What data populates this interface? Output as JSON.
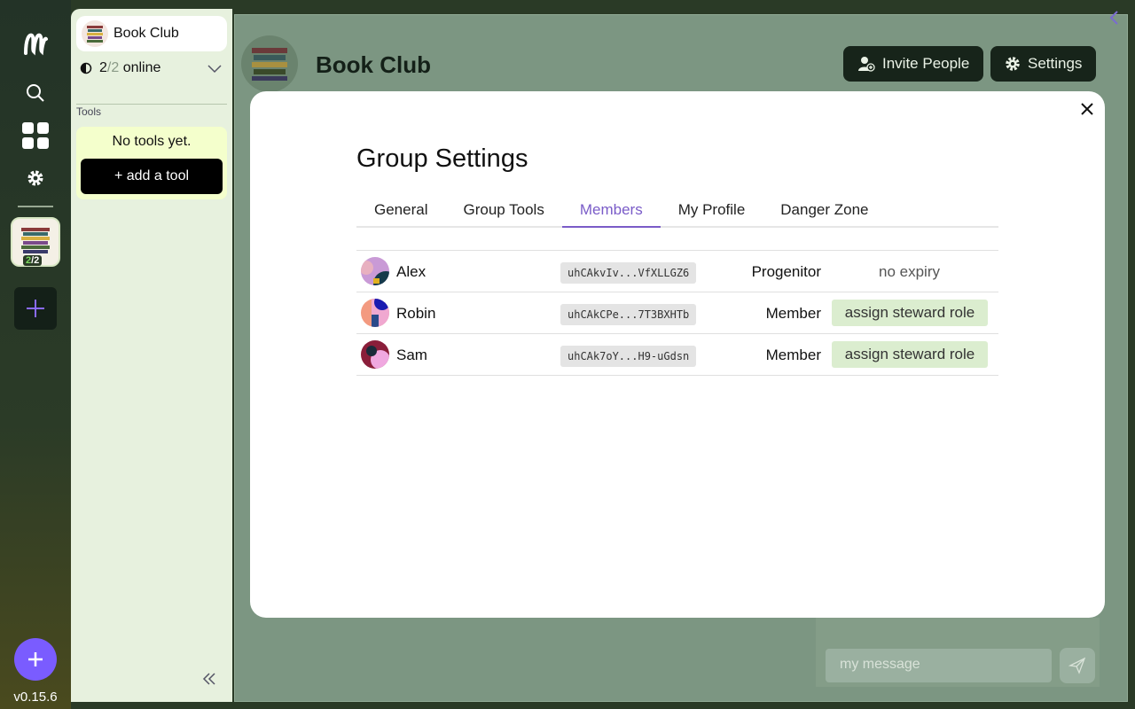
{
  "rail": {
    "version": "v0.15.6",
    "group_count_online": "2",
    "group_count_total": "/2"
  },
  "sidebar": {
    "group_name": "Book Club",
    "online_count": "2",
    "online_total": "/2",
    "online_label": " online",
    "tools_label": "Tools",
    "no_tools": "No tools yet.",
    "add_tool": "+ add a tool"
  },
  "header": {
    "title": "Book Club",
    "invite_label": "Invite People",
    "settings_label": "Settings"
  },
  "composer": {
    "placeholder": "my message"
  },
  "modal": {
    "title": "Group Settings",
    "tabs": [
      {
        "label": "General"
      },
      {
        "label": "Group Tools"
      },
      {
        "label": "Members"
      },
      {
        "label": "My Profile"
      },
      {
        "label": "Danger Zone"
      }
    ],
    "members": [
      {
        "name": "Alex",
        "key": "uhCAkvIv...VfXLLGZ6",
        "role": "Progenitor",
        "expiry": "no expiry"
      },
      {
        "name": "Robin",
        "key": "uhCAkCPe...7T3BXHTb",
        "role": "Member",
        "action": "assign steward role"
      },
      {
        "name": "Sam",
        "key": "uhCAk7oY...H9-uGdsn",
        "role": "Member",
        "action": "assign steward role"
      }
    ]
  },
  "colors": {
    "accent": "#7a5cc8",
    "overlay": "#7c9682",
    "sidebar": "#e7f1de",
    "steward_button": "#dbedcf"
  }
}
